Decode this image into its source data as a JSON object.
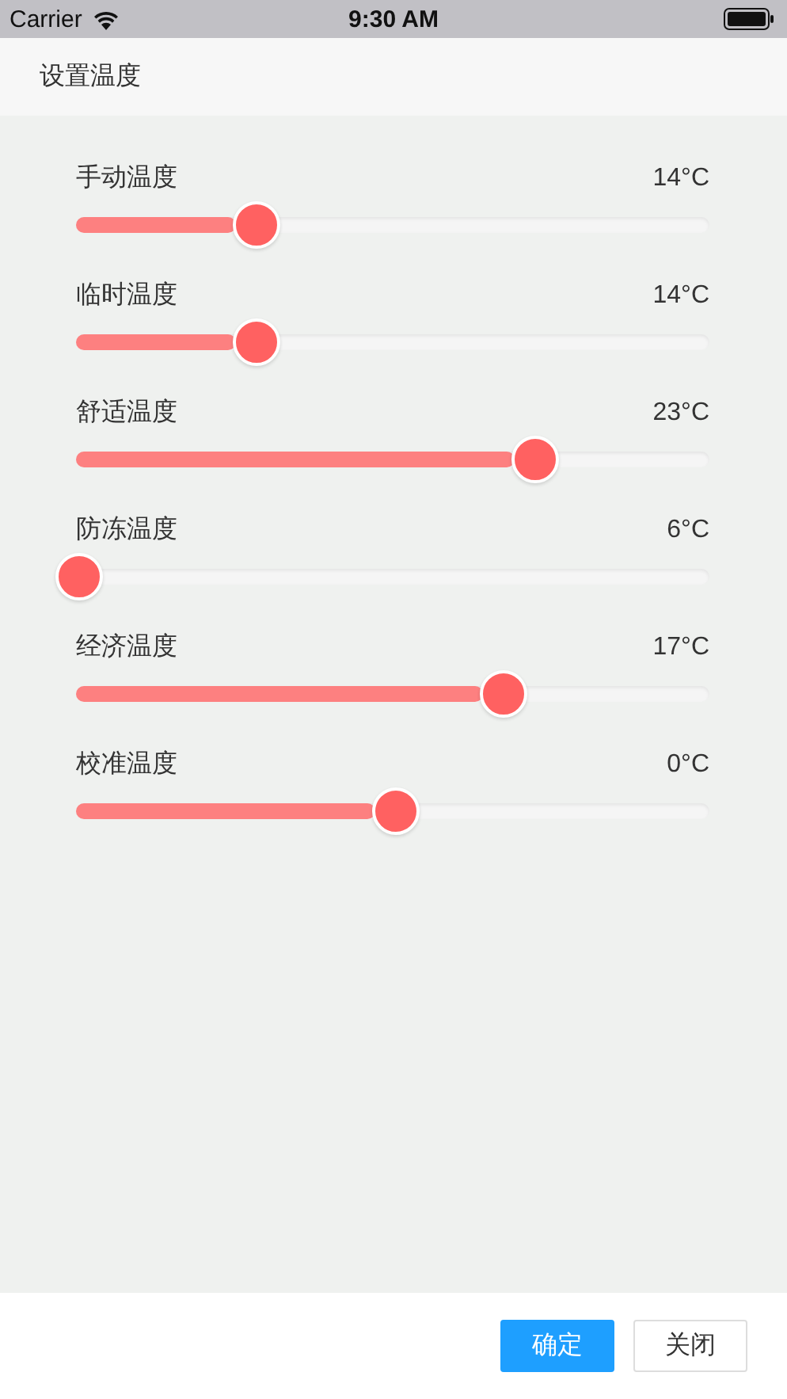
{
  "status_bar": {
    "carrier": "Carrier",
    "time": "9:30 AM"
  },
  "header": {
    "title": "设置温度"
  },
  "sliders": [
    {
      "label": "手动温度",
      "reading": "14°C",
      "level": 0.28
    },
    {
      "label": "临时温度",
      "reading": "14°C",
      "level": 0.28
    },
    {
      "label": "舒适温度",
      "reading": "23°C",
      "level": 0.72
    },
    {
      "label": "防冻温度",
      "reading": "6°C",
      "level": 0
    },
    {
      "label": "经济温度",
      "reading": "17°C",
      "level": 0.67
    },
    {
      "label": "校准温度",
      "reading": "0°C",
      "level": 0.5
    }
  ],
  "buttons": [
    {
      "label": "确定",
      "kind": "primary"
    },
    {
      "label": "关闭",
      "kind": "default"
    }
  ]
}
